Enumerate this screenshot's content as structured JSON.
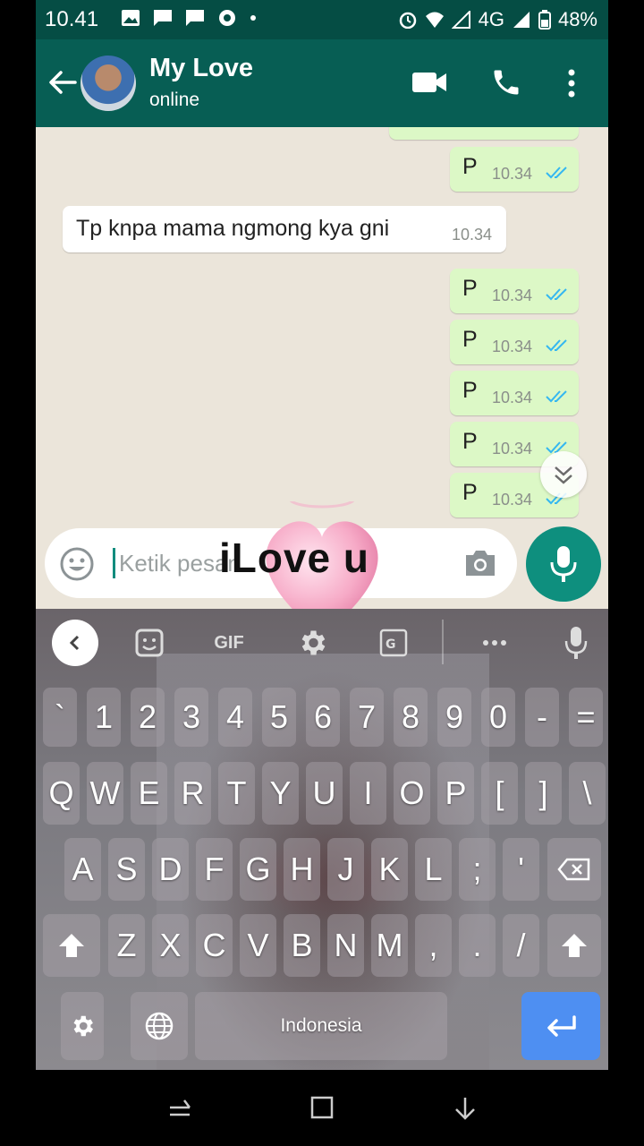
{
  "status_bar": {
    "time": "10.41",
    "network": "4G",
    "battery": "48%"
  },
  "header": {
    "contact_name": "My Love",
    "contact_status": "online"
  },
  "messages": [
    {
      "dir": "out",
      "text": "P",
      "time": "10.34",
      "read": true
    },
    {
      "dir": "in",
      "text": "Tp knpa mama ngmong kya gni",
      "time": "10.34"
    },
    {
      "dir": "out",
      "text": "P",
      "time": "10.34",
      "read": true
    },
    {
      "dir": "out",
      "text": "P",
      "time": "10.34",
      "read": true
    },
    {
      "dir": "out",
      "text": "P",
      "time": "10.34",
      "read": true
    },
    {
      "dir": "out",
      "text": "P",
      "time": "10.34",
      "read": true
    },
    {
      "dir": "out",
      "text": "P",
      "time": "10.34",
      "read": true
    }
  ],
  "input": {
    "placeholder": "Ketik pesan"
  },
  "sticker": {
    "text": "iLove  u"
  },
  "keyboard": {
    "toolbar": {
      "gif_label": "GIF"
    },
    "rows": [
      [
        "`",
        "1",
        "2",
        "3",
        "4",
        "5",
        "6",
        "7",
        "8",
        "9",
        "0",
        "-",
        "="
      ],
      [
        "Q",
        "W",
        "E",
        "R",
        "T",
        "Y",
        "U",
        "I",
        "O",
        "P",
        "[",
        "]",
        "\\"
      ],
      [
        "A",
        "S",
        "D",
        "F",
        "G",
        "H",
        "J",
        "K",
        "L",
        ";",
        "'"
      ],
      [
        "Z",
        "X",
        "C",
        "V",
        "B",
        "N",
        "M",
        ",",
        ".",
        "/"
      ]
    ],
    "space_label": "Indonesia"
  },
  "colors": {
    "header": "#075e54",
    "status_bar": "#054d44",
    "outgoing_bubble": "#dcf8c6",
    "accent": "#0e8f7e",
    "read_ticks": "#34b7f1",
    "enter_key": "#4e8ff2"
  }
}
